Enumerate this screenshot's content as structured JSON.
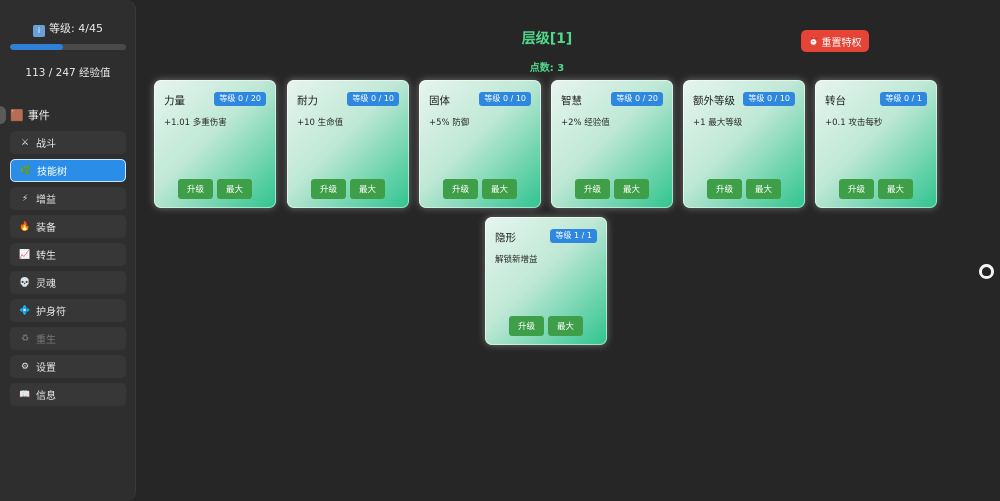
{
  "sidebar": {
    "level_text": "等级: 4/45",
    "level_icon": "info-icon",
    "xp_progress": 0.457,
    "xp_text": "113 / 247 经验值",
    "section_title": "事件",
    "items": [
      {
        "icon": "⚔",
        "label": "战斗",
        "state": "normal"
      },
      {
        "icon": "🌿",
        "label": "技能树",
        "state": "active"
      },
      {
        "icon": "⚡",
        "label": "增益",
        "state": "normal"
      },
      {
        "icon": "🔥",
        "label": "装备",
        "state": "normal"
      },
      {
        "icon": "📈",
        "label": "转生",
        "state": "normal"
      },
      {
        "icon": "💀",
        "label": "灵魂",
        "state": "normal"
      },
      {
        "icon": "💠",
        "label": "护身符",
        "state": "normal"
      },
      {
        "icon": "♻",
        "label": "重生",
        "state": "disabled"
      },
      {
        "icon": "⚙",
        "label": "设置",
        "state": "normal"
      },
      {
        "icon": "📖",
        "label": "信息",
        "state": "normal"
      }
    ]
  },
  "main": {
    "title": "层级[1]",
    "points_text": "点数: 3",
    "reset_label": "重置特权",
    "reset_icon": "clock-icon"
  },
  "cards": [
    {
      "name": "力量",
      "badge": "等级 0 / 20",
      "desc": "+1.01 多重伤害",
      "upgrade": "升级",
      "max": "最大"
    },
    {
      "name": "耐力",
      "badge": "等级 0 / 10",
      "desc": "+10 生命值",
      "upgrade": "升级",
      "max": "最大"
    },
    {
      "name": "固体",
      "badge": "等级 0 / 10",
      "desc": "+5% 防御",
      "upgrade": "升级",
      "max": "最大"
    },
    {
      "name": "智慧",
      "badge": "等级 0 / 20",
      "desc": "+2% 经验值",
      "upgrade": "升级",
      "max": "最大"
    },
    {
      "name": "额外等级",
      "badge": "等级 0 / 10",
      "desc": "+1 最大等级",
      "upgrade": "升级",
      "max": "最大"
    },
    {
      "name": "转台",
      "badge": "等级 0 / 1",
      "desc": "+0.1 攻击每秒",
      "upgrade": "升级",
      "max": "最大"
    },
    {
      "name": "隐形",
      "badge": "等级 1 / 1",
      "desc": "解锁新增益",
      "upgrade": "升级",
      "max": "最大"
    }
  ],
  "colors": {
    "accent": "#2a8ee8",
    "title_green": "#52d68a",
    "reset_red": "#e74438",
    "button_green": "#3f9f49"
  }
}
